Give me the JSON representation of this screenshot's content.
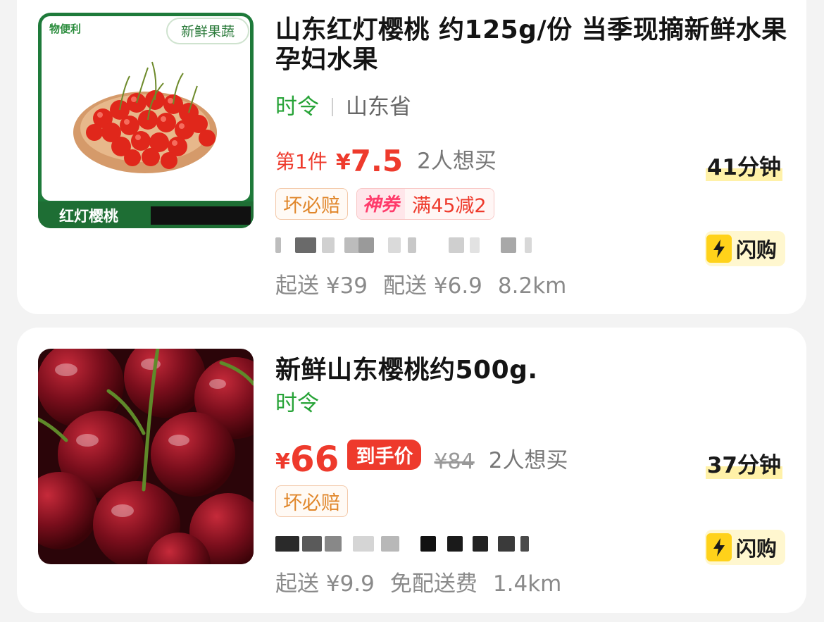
{
  "products": [
    {
      "title": "山东红灯樱桃 约125g/份 当季现摘新鲜水果孕妇水果",
      "badge": "时令",
      "region": "山东省",
      "price_prefix": "第1件",
      "currency": "¥",
      "price": "7.5",
      "want": "2人想买",
      "eta": "41分钟",
      "tag_guarantee": "坏必赔",
      "coupon_label": "神券",
      "coupon_text": "满45减2",
      "thumb_brand": "物便利",
      "thumb_badge": "新鲜果蔬",
      "thumb_caption": "红灯樱桃",
      "delivery_min": "起送 ¥39",
      "delivery_fee": "配送 ¥6.9",
      "distance": "8.2km",
      "flash": "闪购"
    },
    {
      "title": "新鲜山东樱桃约500g.",
      "badge": "时令",
      "currency": "¥",
      "price": "66",
      "price_tag": "到手价",
      "original_price": "¥84",
      "want": "2人想买",
      "eta": "37分钟",
      "tag_guarantee": "坏必赔",
      "delivery_min": "起送 ¥9.9",
      "delivery_fee": "免配送费",
      "distance": "1.4km",
      "flash": "闪购"
    }
  ],
  "colors": {
    "price_red": "#ee3a2c",
    "green": "#27a337",
    "flash_yellow": "#ffd21a"
  },
  "icons": [
    "bolt-icon"
  ]
}
